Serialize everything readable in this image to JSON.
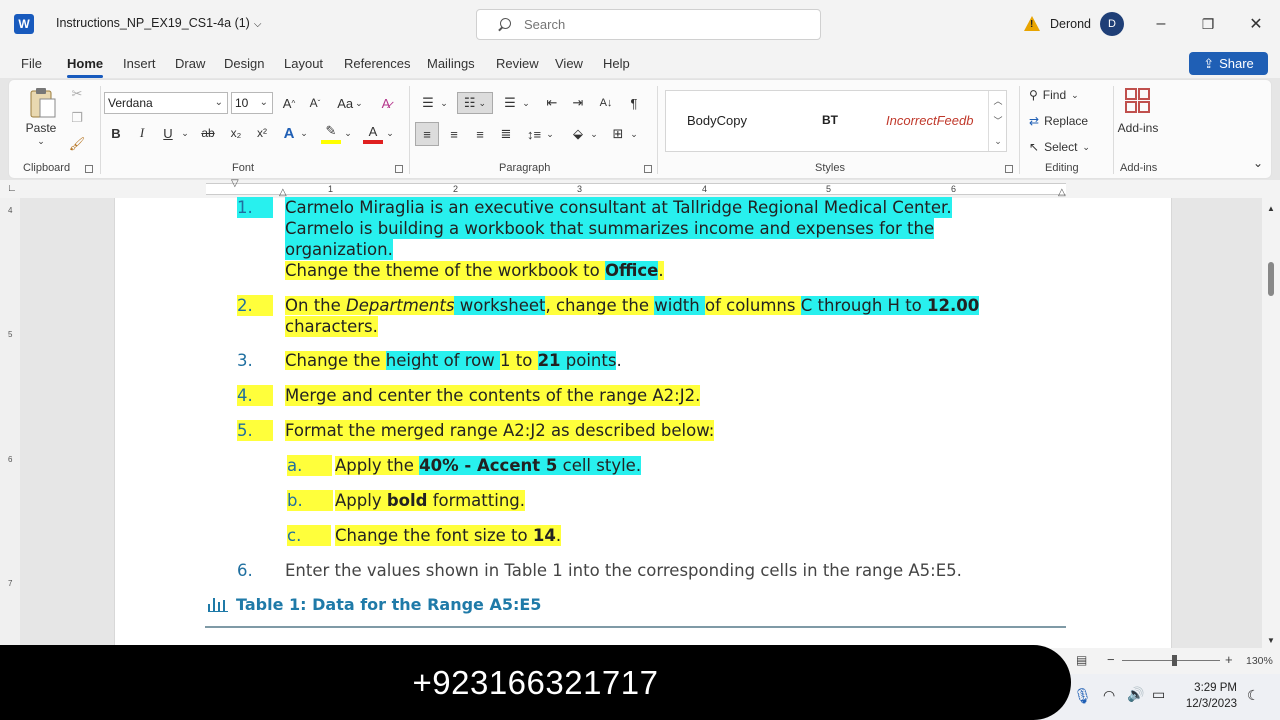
{
  "title_bar": {
    "app_logo": "W",
    "doc_title": "Instructions_NP_EX19_CS1-4a (1)",
    "search_placeholder": "Search",
    "warning_icon": "warning-triangle-icon",
    "username": "Derond",
    "avatar_initial": "D",
    "minimize": "–",
    "restore": "❐",
    "close": "✕"
  },
  "menu": {
    "tabs": [
      "File",
      "Home",
      "Insert",
      "Draw",
      "Design",
      "Layout",
      "References",
      "Mailings",
      "Review",
      "View",
      "Help"
    ],
    "active_tab": "Home",
    "share_label": "Share"
  },
  "ribbon": {
    "clipboard": {
      "label": "Clipboard",
      "paste": "Paste"
    },
    "font": {
      "label": "Font",
      "font_name": "Verdana",
      "font_size": "10",
      "change_case": "Aa",
      "bold": "B",
      "italic": "I",
      "underline": "U",
      "strike": "ab",
      "subscript": "x₂",
      "superscript": "x²"
    },
    "paragraph": {
      "label": "Paragraph"
    },
    "styles": {
      "label": "Styles",
      "items": [
        "BodyCopy",
        "BT",
        "IncorrectFeedb"
      ]
    },
    "editing": {
      "label": "Editing",
      "find": "Find",
      "replace": "Replace",
      "select": "Select"
    },
    "addins": {
      "label": "Add-ins",
      "button": "Add-ins"
    }
  },
  "ruler": {
    "numbers": [
      "1",
      "2",
      "3",
      "4",
      "5",
      "6"
    ]
  },
  "vertical_ruler": [
    "4",
    "5",
    "6",
    "7"
  ],
  "document": {
    "items": [
      {
        "num": "1.",
        "lines": [
          "Carmelo Miraglia is an executive consultant at Tallridge Regional Medical Center.",
          "Carmelo is building a workbook that summarizes income and expenses for the",
          "organization."
        ],
        "line4_pre": "Change the theme of the workbook to ",
        "line4_bold": "Office",
        "line4_post": "."
      },
      {
        "num": "2.",
        "seg": [
          "On the ",
          "Departments",
          " worksheet",
          ", change the ",
          "width ",
          "of columns ",
          "C through H to ",
          "12.00"
        ],
        "cont": "characters."
      },
      {
        "num": "3.",
        "seg": [
          "Change the ",
          "height of row ",
          "1 to ",
          "21",
          " points",
          "."
        ]
      },
      {
        "num": "4.",
        "text": "Merge and center the contents of the range A2:J2."
      },
      {
        "num": "5.",
        "text": "Format the merged range A2:J2 as described below:"
      },
      {
        "num": "a.",
        "seg": [
          "Apply the ",
          "40% - Accent 5",
          " cell style."
        ]
      },
      {
        "num": "b.",
        "seg": [
          "Apply ",
          "bold",
          " formatting."
        ]
      },
      {
        "num": "c.",
        "seg": [
          "Change the font size to ",
          "14",
          "."
        ]
      },
      {
        "num": "6.",
        "text": "Enter the values shown in Table 1 into the corresponding cells in the range A5:E5."
      }
    ],
    "table_caption": "Table 1: Data for the Range A5:E5"
  },
  "status": {
    "zoom": "130%",
    "minus": "−",
    "plus": "+"
  },
  "overlay": {
    "phone": "+923166321717"
  },
  "taskbar": {
    "time": "3:29 PM",
    "date": "12/3/2023"
  },
  "colors": {
    "accent": "#185abd",
    "highlight_yellow": "#ffff3b",
    "highlight_cyan": "#28f0ee",
    "list_number": "#1f6fa0"
  }
}
